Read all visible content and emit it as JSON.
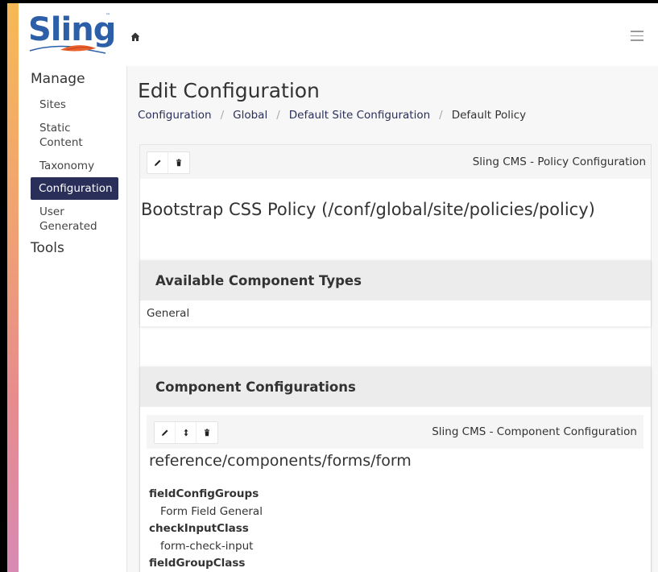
{
  "app": {
    "logo_text": "Sling",
    "logo_tm": "™"
  },
  "icons": {
    "home": "home-icon",
    "menu": "hamburger-menu-icon",
    "edit": "pencil-icon",
    "delete": "trash-icon",
    "move": "up-down-arrows-icon"
  },
  "colors": {
    "brand": "#2c5fa8",
    "active_nav": "#2a2f5a",
    "accent_top": "#f7b955",
    "accent_bottom": "#d78ab3"
  },
  "sidebar": {
    "manage_heading": "Manage",
    "items": [
      {
        "label": "Sites"
      },
      {
        "label": "Static Content"
      },
      {
        "label": "Taxonomy"
      },
      {
        "label": "Configuration",
        "active": true
      },
      {
        "label": "User Generated"
      }
    ],
    "tools_heading": "Tools"
  },
  "main": {
    "title": "Edit Configuration",
    "breadcrumb": [
      {
        "label": "Configuration"
      },
      {
        "label": "Global"
      },
      {
        "label": "Default Site Configuration"
      },
      {
        "label": "Default Policy"
      }
    ],
    "breadcrumb_sep": "/",
    "panel": {
      "label": "Sling CMS - Policy Configuration",
      "policy_title": "Bootstrap CSS Policy (/conf/global/site/policies/policy)",
      "available_types": {
        "header": "Available Component Types",
        "value": "General"
      },
      "component_configs": {
        "header": "Component Configurations",
        "toolbar_label": "Sling CMS - Component Configuration",
        "component_path": "reference/components/forms/form",
        "properties": [
          {
            "key": "fieldConfigGroups",
            "value": "Form Field General"
          },
          {
            "key": "checkInputClass",
            "value": "form-check-input"
          },
          {
            "key": "fieldGroupClass",
            "value": ""
          }
        ]
      }
    }
  }
}
